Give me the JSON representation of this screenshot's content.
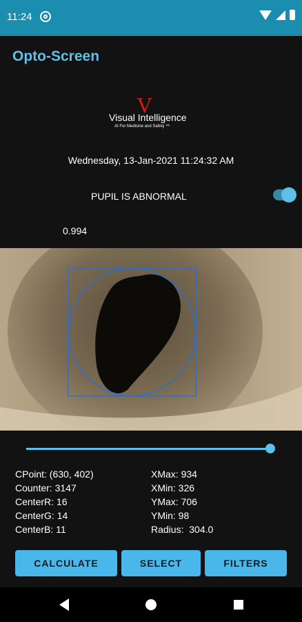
{
  "status_bar": {
    "time": "11:24"
  },
  "app": {
    "title": "Opto-Screen"
  },
  "logo": {
    "letter": "V",
    "brand": "Visual Intelligence",
    "tagline": "AI For Medicine and Safety ™"
  },
  "datetime": "Wednesday, 13-Jan-2021 11:24:32 AM",
  "pupil_status": "PUPIL IS ABNORMAL",
  "toggle_on": true,
  "score": "0.994",
  "slider_value": 1.0,
  "stats": {
    "cpoint": "CPoint: (630, 402)",
    "counter": "Counter: 3147",
    "center_r": "CenterR: 16",
    "center_g": "CenterG: 14",
    "center_b": "CenterB: 11",
    "xmax": "XMax: 934",
    "xmin": "XMin: 326",
    "ymax": "YMax: 706",
    "ymin": "YMin: 98",
    "radius": "Radius:  304.0"
  },
  "buttons": {
    "calculate": "CALCULATE",
    "select": "SELECT",
    "filters": "FILTERS"
  },
  "colors": {
    "accent": "#5cc0e8",
    "status_bar": "#1b8eb0",
    "logo_v": "#d21d1d"
  }
}
